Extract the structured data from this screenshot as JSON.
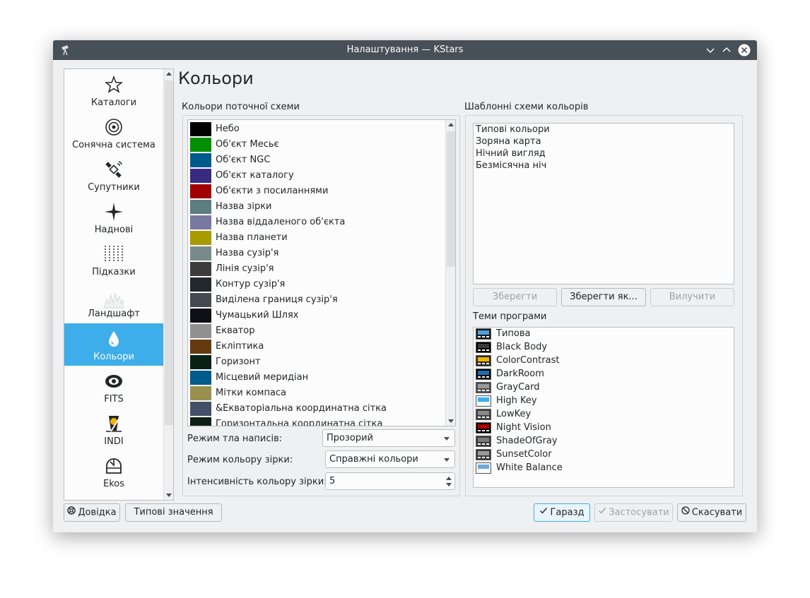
{
  "window": {
    "title": "Налаштування — KStars"
  },
  "sidebar": {
    "items": [
      {
        "label": "Каталоги",
        "icon": "star-outline-icon"
      },
      {
        "label": "Сонячна система",
        "icon": "solar-system-icon"
      },
      {
        "label": "Супутники",
        "icon": "satellite-icon"
      },
      {
        "label": "Наднові",
        "icon": "supernova-icon"
      },
      {
        "label": "Підказки",
        "icon": "guides-icon"
      },
      {
        "label": "Ландшафт",
        "icon": "landscape-icon"
      },
      {
        "label": "Кольори",
        "icon": "color-drop-icon",
        "active": true
      },
      {
        "label": "FITS",
        "icon": "fits-icon"
      },
      {
        "label": "INDI",
        "icon": "indi-icon"
      },
      {
        "label": "Ekos",
        "icon": "ekos-icon"
      }
    ]
  },
  "page": {
    "title": "Кольори",
    "current_scheme_label": "Кольори поточної схеми",
    "template_schemes_label": "Шаблонні схеми кольорів",
    "themes_label": "Теми програми"
  },
  "colors": [
    {
      "name": "Небо",
      "color": "#000000"
    },
    {
      "name": "Об'єкт Месьє",
      "color": "#008f00"
    },
    {
      "name": "Об'єкт NGC",
      "color": "#005a8c"
    },
    {
      "name": "Об'єкт каталогу",
      "color": "#3a2a82"
    },
    {
      "name": "Об'єкти з посиланнями",
      "color": "#a00000"
    },
    {
      "name": "Назва зірки",
      "color": "#5a7e82"
    },
    {
      "name": "Назва віддаленого об'єкта",
      "color": "#7878a0"
    },
    {
      "name": "Назва планети",
      "color": "#a89a00"
    },
    {
      "name": "Назва сузір'я",
      "color": "#788a8c"
    },
    {
      "name": "Лінія сузір'я",
      "color": "#3c3c3c"
    },
    {
      "name": "Контур сузір'я",
      "color": "#22292c"
    },
    {
      "name": "Виділена границя сузір'я",
      "color": "#434b50"
    },
    {
      "name": "Чумацький Шлях",
      "color": "#0e1015"
    },
    {
      "name": "Екватор",
      "color": "#909090"
    },
    {
      "name": "Екліптика",
      "color": "#663a10"
    },
    {
      "name": "Горизонт",
      "color": "#0a2014"
    },
    {
      "name": "Місцевий меридіан",
      "color": "#005a8c"
    },
    {
      "name": "Мітки компаса",
      "color": "#999050"
    },
    {
      "name": "&Екваторіальна координатна сітка",
      "color": "#445068"
    },
    {
      "name": "Горизонтальна координатна сітка",
      "color": "#0c2016"
    }
  ],
  "form": {
    "bg_mode_label": "Режим тла написів:",
    "bg_mode_value": "Прозорий",
    "star_color_mode_label": "Режим кольору зірки:",
    "star_color_mode_value": "Справжні кольори",
    "star_intensity_label": "Інтенсивність кольору зірки:",
    "star_intensity_value": "5"
  },
  "schemes": [
    "Типові кольори",
    "Зоряна карта",
    "Нічний вигляд",
    "Безмісячна ніч"
  ],
  "scheme_buttons": {
    "save": "Зберегти",
    "save_as": "Зберегти як...",
    "remove": "Вилучити"
  },
  "themes": [
    {
      "name": "Типова",
      "icon": "theme-default-icon"
    },
    {
      "name": "Black Body",
      "icon": "theme-blackbody-icon"
    },
    {
      "name": "ColorContrast",
      "icon": "theme-colorcontrast-icon"
    },
    {
      "name": "DarkRoom",
      "icon": "theme-darkroom-icon"
    },
    {
      "name": "GrayCard",
      "icon": "theme-graycard-icon"
    },
    {
      "name": "High Key",
      "icon": "theme-highkey-icon"
    },
    {
      "name": "LowKey",
      "icon": "theme-lowkey-icon"
    },
    {
      "name": "Night Vision",
      "icon": "theme-nightvision-icon"
    },
    {
      "name": "ShadeOfGray",
      "icon": "theme-shadeofgray-icon"
    },
    {
      "name": "SunsetColor",
      "icon": "theme-sunsetcolor-icon"
    },
    {
      "name": "White Balance",
      "icon": "theme-whitebalance-icon"
    }
  ],
  "footer": {
    "help": "Довідка",
    "defaults": "Типові значення",
    "ok": "Гаразд",
    "apply": "Застосувати",
    "cancel": "Скасувати"
  },
  "accent_color": "#3daee9"
}
